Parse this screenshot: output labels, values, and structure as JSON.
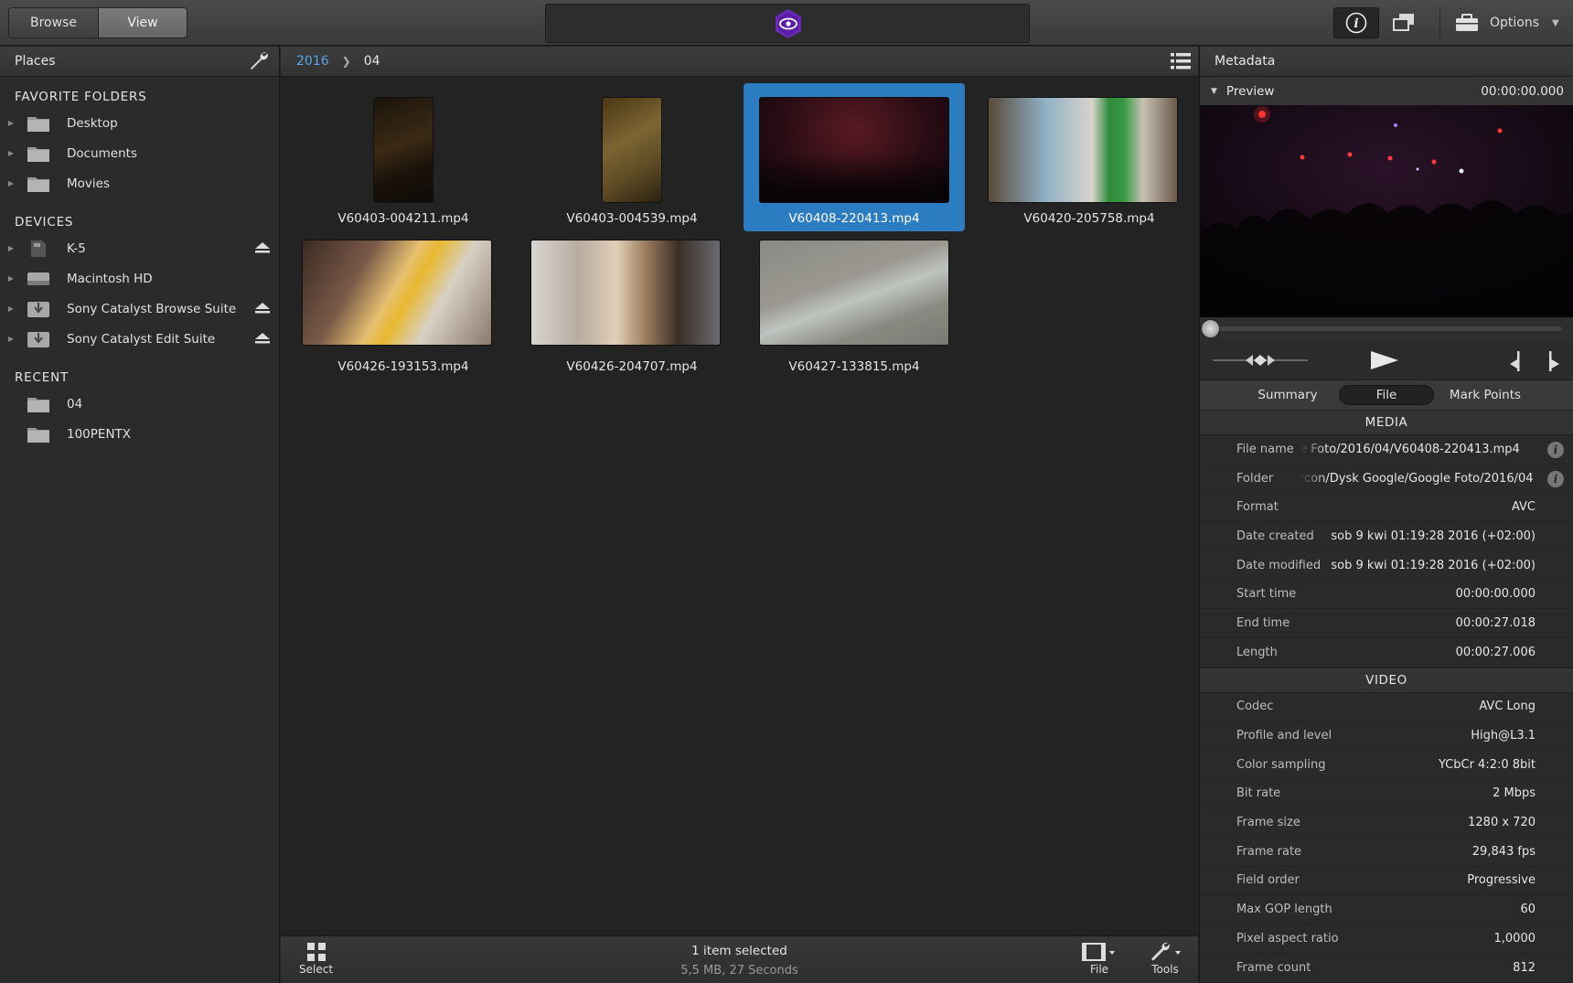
{
  "toolbar": {
    "browse_label": "Browse",
    "view_label": "View",
    "options_label": "Options"
  },
  "sidebar": {
    "title": "Places",
    "favorites_title": "FAVORITE FOLDERS",
    "favorites": [
      "Desktop",
      "Documents",
      "Movies"
    ],
    "devices_title": "DEVICES",
    "devices": [
      "K-5",
      "Macintosh HD",
      "Sony Catalyst Browse Suite",
      "Sony Catalyst Edit Suite"
    ],
    "recent_title": "RECENT",
    "recent": [
      "04",
      "100PENTX"
    ]
  },
  "breadcrumb": {
    "parent": "2016",
    "current": "04"
  },
  "files": [
    {
      "name": "V60403-004211.mp4"
    },
    {
      "name": "V60403-004539.mp4"
    },
    {
      "name": "V60408-220413.mp4",
      "selected": true
    },
    {
      "name": "V60420-205758.mp4"
    },
    {
      "name": "V60426-193153.mp4"
    },
    {
      "name": "V60426-204707.mp4"
    },
    {
      "name": "V60427-133815.mp4"
    }
  ],
  "bottombar": {
    "select_label": "Select",
    "status": "1 item selected",
    "details": "5,5 MB, 27 Seconds",
    "file_label": "File",
    "tools_label": "Tools"
  },
  "metadata": {
    "title": "Metadata",
    "preview_label": "Preview",
    "timecode": "00:00:00.000",
    "tabs": [
      "Summary",
      "File",
      "Mark Points"
    ],
    "media_title": "MEDIA",
    "media": [
      {
        "k": "File name",
        "v": "e Foto/2016/04/V60408-220413.mp4"
      },
      {
        "k": "Folder",
        "v": "rcon/Dysk Google/Google Foto/2016/04"
      },
      {
        "k": "Format",
        "v": "AVC"
      },
      {
        "k": "Date created",
        "v": "sob  9 kwi 01:19:28 2016 (+02:00)"
      },
      {
        "k": "Date modified",
        "v": "sob  9 kwi 01:19:28 2016 (+02:00)"
      },
      {
        "k": "Start time",
        "v": "00:00:00.000"
      },
      {
        "k": "End time",
        "v": "00:00:27.018"
      },
      {
        "k": "Length",
        "v": "00:00:27.006"
      }
    ],
    "video_title": "VIDEO",
    "video": [
      {
        "k": "Codec",
        "v": "AVC Long"
      },
      {
        "k": "Profile and level",
        "v": "High@L3.1"
      },
      {
        "k": "Color sampling",
        "v": "YCbCr 4:2:0 8bit"
      },
      {
        "k": "Bit rate",
        "v": "2 Mbps"
      },
      {
        "k": "Frame size",
        "v": "1280 x 720"
      },
      {
        "k": "Frame rate",
        "v": "29,843 fps"
      },
      {
        "k": "Field order",
        "v": "Progressive"
      },
      {
        "k": "Max GOP length",
        "v": "60"
      },
      {
        "k": "Pixel aspect ratio",
        "v": "1,0000"
      },
      {
        "k": "Frame count",
        "v": "812"
      }
    ]
  },
  "colors": {
    "accent": "#2c7cc2",
    "link": "#5aa7e6",
    "app_icon": "#6a2ab8"
  }
}
